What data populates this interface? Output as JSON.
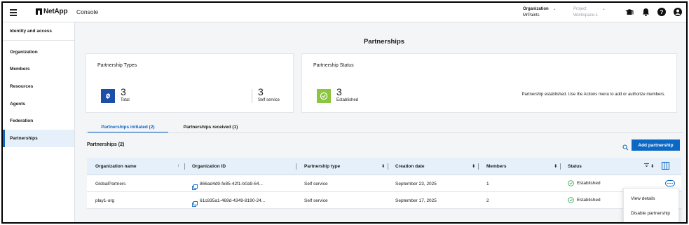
{
  "app": {
    "logo_text": "NetApp",
    "title": "Console"
  },
  "header": {
    "organization": {
      "label": "Organization",
      "value": "MrPaints"
    },
    "project": {
      "label": "Project",
      "value": "Workspace-1"
    },
    "icons": [
      "graduation-cap-icon",
      "bell-icon",
      "help-icon",
      "user-icon"
    ]
  },
  "sidebar": {
    "heading": "Identity and access",
    "items": [
      {
        "label": "Organization"
      },
      {
        "label": "Members"
      },
      {
        "label": "Resources"
      },
      {
        "label": "Agents"
      },
      {
        "label": "Federation"
      },
      {
        "label": "Partnerships",
        "active": true
      }
    ]
  },
  "page": {
    "title": "Partnerships"
  },
  "types_card": {
    "title": "Partnership Types",
    "total": {
      "value": "3",
      "label": "Total"
    },
    "self_service": {
      "value": "3",
      "label": "Self service"
    },
    "icon_color": "#1e4fa8"
  },
  "status_card": {
    "title": "Partnership Status",
    "established": {
      "value": "3",
      "label": "Established"
    },
    "message": "Partnership established. Use the Actions menu to add or authorize members.",
    "icon_color": "#8cc63f"
  },
  "tabs": [
    {
      "label": "Partnerships initiated (2)",
      "active": true
    },
    {
      "label": "Partnerships received (1)",
      "active": false
    }
  ],
  "list": {
    "title": "Partnerships (2)",
    "add_button": "Add partnership",
    "columns": [
      "Organization name",
      "Organization ID",
      "Partnership type",
      "Creation date",
      "Members",
      "Status"
    ],
    "rows": [
      {
        "name": "GlobalPartners",
        "org_id": "866ad4d9-fe85-42f1-b0a9-64...",
        "type": "Self service",
        "created": "September 23, 2025",
        "members": "1",
        "status": "Established"
      },
      {
        "name": "play1-org",
        "org_id": "61c835a1-469d-4349-8190-24...",
        "type": "Self service",
        "created": "September 17, 2025",
        "members": "2",
        "status": "Established"
      }
    ]
  },
  "actions_menu": {
    "items": [
      "View details",
      "Disable partnership"
    ]
  },
  "colors": {
    "accent": "#0b68c5",
    "header_row": "#e6f0fb",
    "success": "#3aa657"
  }
}
